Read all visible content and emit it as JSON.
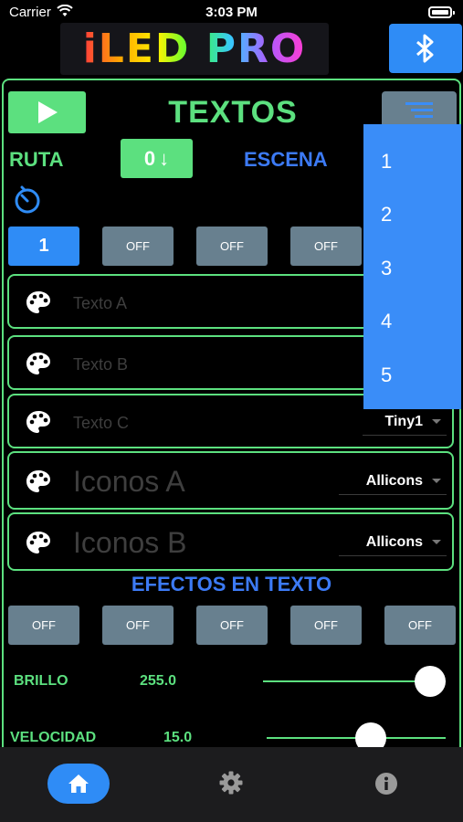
{
  "status_bar": {
    "carrier": "Carrier",
    "time": "3:03 PM"
  },
  "logo": {
    "text": "iLED PRO"
  },
  "header": {
    "title": "TEXTOS"
  },
  "ruta": {
    "label": "RUTA",
    "value": "0",
    "arrow": "↓"
  },
  "escena": {
    "label": "ESCENA"
  },
  "scene_buttons": [
    "1",
    "OFF",
    "OFF",
    "OFF"
  ],
  "text_rows": [
    {
      "placeholder": "Texto A",
      "icon": "palette-icon"
    },
    {
      "placeholder": "Texto B",
      "icon": "palette-icon"
    },
    {
      "placeholder": "Texto C",
      "icon": "palette-icon",
      "font": "Tiny1"
    },
    {
      "placeholder": "Iconos A",
      "icon": "palette-icon",
      "font": "Allicons"
    },
    {
      "placeholder": "Iconos B",
      "icon": "palette-icon",
      "font": "Allicons"
    }
  ],
  "efectos": {
    "title": "EFECTOS EN TEXTO",
    "buttons": [
      "OFF",
      "OFF",
      "OFF",
      "OFF",
      "OFF"
    ]
  },
  "sliders": [
    {
      "label": "BRILLO",
      "value_text": "255.0",
      "value": 255,
      "max": 255
    },
    {
      "label": "VELOCIDAD",
      "value_text": "15.0",
      "value": 15,
      "max": 25
    }
  ],
  "dropdown": {
    "options": [
      "1",
      "2",
      "3",
      "4",
      "5"
    ]
  },
  "tabs": [
    {
      "name": "home-icon",
      "active": true
    },
    {
      "name": "gear-icon",
      "active": false
    },
    {
      "name": "info-icon",
      "active": false
    }
  ],
  "colors": {
    "green": "#5ce07f",
    "blue": "#2f8cf6",
    "gray": "#68808f",
    "dropdown": "#3a8df8"
  }
}
